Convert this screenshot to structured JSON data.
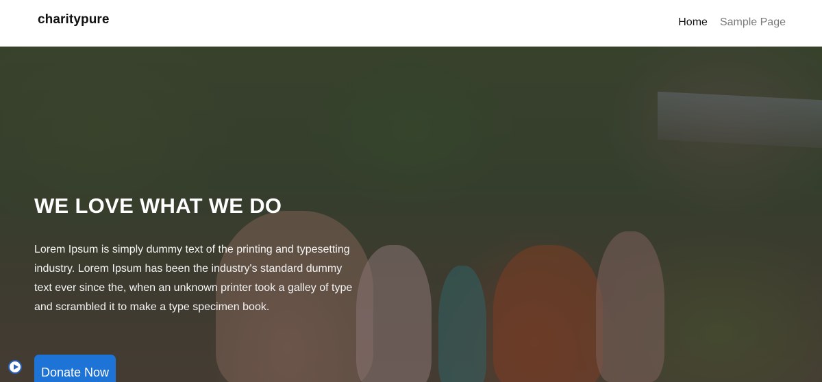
{
  "header": {
    "logo": "charitypure",
    "nav": [
      {
        "label": "Home",
        "active": true
      },
      {
        "label": "Sample Page",
        "active": false
      }
    ]
  },
  "hero": {
    "title": "WE LOVE WHAT WE DO",
    "text": "Lorem Ipsum is simply dummy text of the printing and typesetting industry. Lorem Ipsum has been the industry's standard dummy text ever since the, when an unknown printer took a galley of type and scrambled it to make a type specimen book.",
    "button_label": "Donate Now",
    "background_image": "children-running-outdoors"
  },
  "colors": {
    "button": "#1e73d6",
    "nav_active": "#111111",
    "nav_muted": "#7a7a7a"
  },
  "icons": {
    "play": "play-circle-icon"
  }
}
